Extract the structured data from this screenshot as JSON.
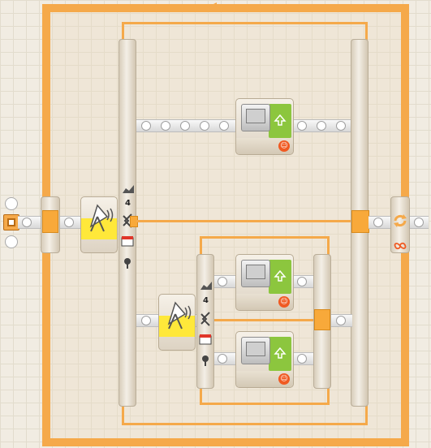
{
  "canvas": {
    "background": "#f1ece2",
    "grid_color": "#e2dccd",
    "accent": "#f5a94a",
    "bar_orange": "#f8a93a",
    "display_green": "#8cc63e",
    "sound_yellow": "#ffe83a"
  },
  "program": {
    "start": {
      "icon": "start-square-icon"
    },
    "outer_loop": {
      "icon": "loop-refresh-icon",
      "control_icon": "infinity-icon"
    },
    "outer_switch": {
      "case_count": "4",
      "icons": [
        "sensor-chart-icon",
        "condition-arrows-icon",
        "calendar-icon",
        "flower-icon"
      ]
    },
    "inner_switch": {
      "case_count": "4",
      "icons": [
        "sensor-chart-icon",
        "condition-arrows-icon",
        "calendar-icon",
        "flower-icon"
      ]
    },
    "sound_blocks": [
      {
        "icon": "satellite-dish-icon"
      },
      {
        "icon": "satellite-dish-icon"
      }
    ],
    "display_blocks": [
      {
        "icon": "monitor-icon",
        "status_icon": "smiley-icon"
      },
      {
        "icon": "monitor-icon",
        "status_icon": "smiley-icon"
      },
      {
        "icon": "monitor-icon",
        "status_icon": "smiley-icon"
      }
    ]
  }
}
